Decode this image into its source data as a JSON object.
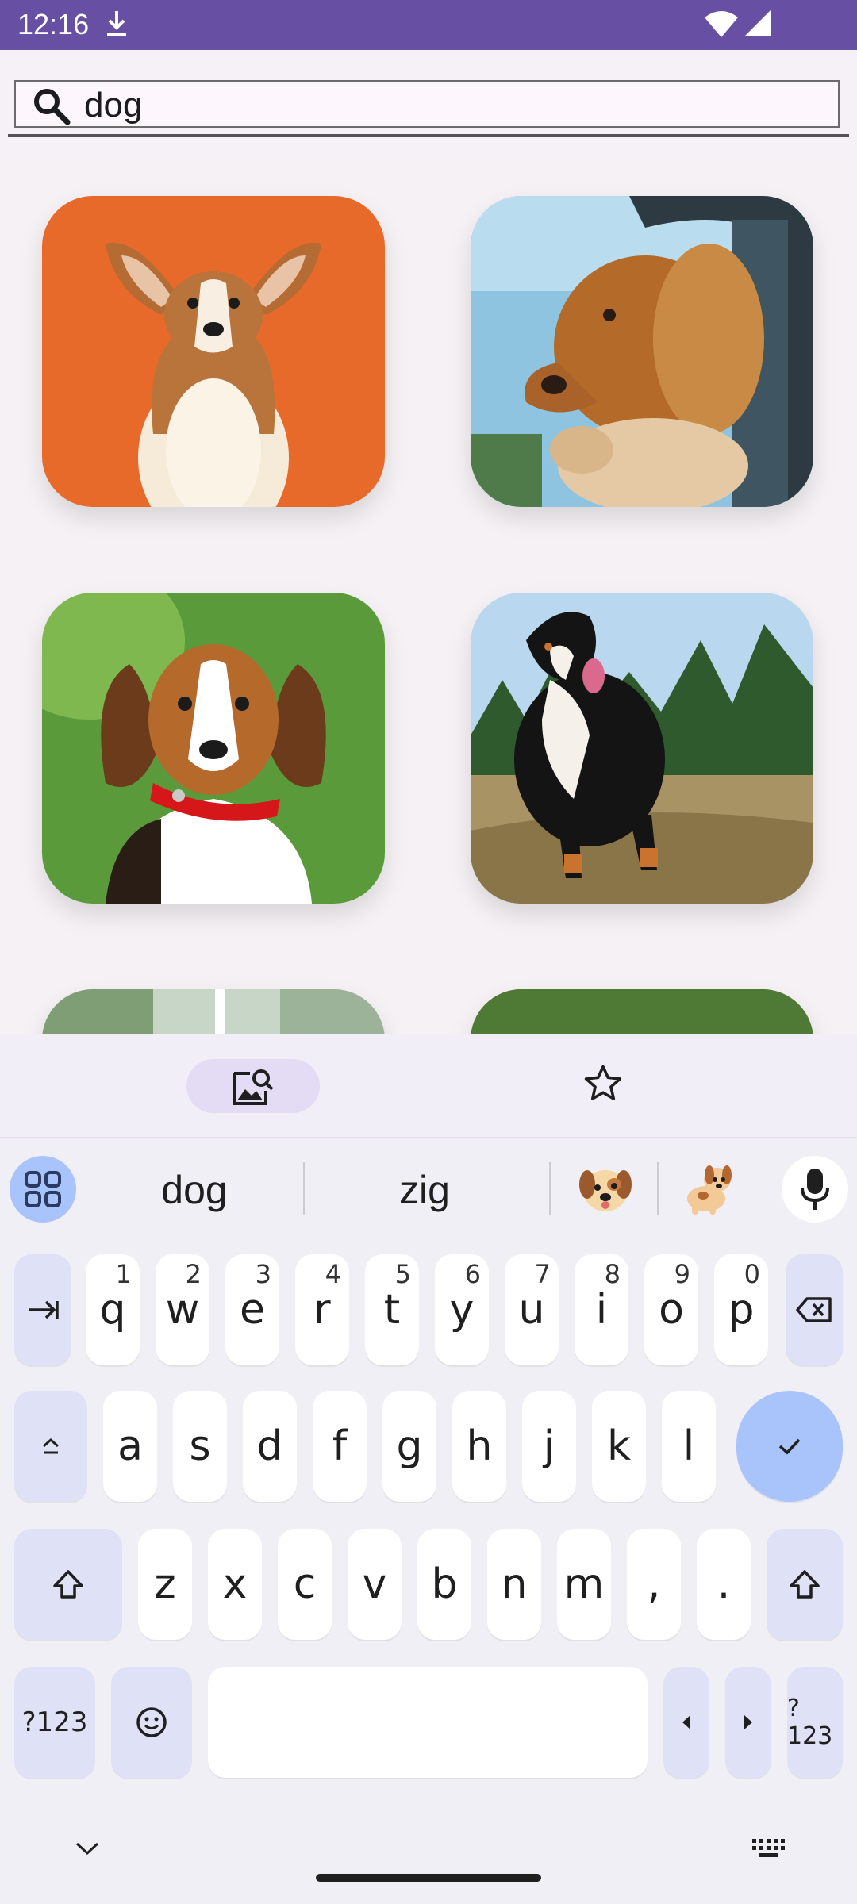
{
  "status_bar": {
    "time": "12:16",
    "icons": [
      "download-icon",
      "wifi-icon",
      "cell-signal-icon"
    ],
    "background": "#6750a4"
  },
  "search": {
    "value": "dog",
    "placeholder": ""
  },
  "results": {
    "items": [
      {
        "subject": "corgi puppy on orange background",
        "bg": "#e86a2a"
      },
      {
        "subject": "spaniel looking out of car window",
        "bg": "#8ec4df"
      },
      {
        "subject": "beagle with red collar on green background",
        "bg": "#5b9a3a"
      },
      {
        "subject": "bernese mountain dog standing in field",
        "bg": "#b9d7ef"
      },
      {
        "subject": "partially visible photo",
        "bg": "#c8d6c8"
      },
      {
        "subject": "partially visible photo",
        "bg": "#5f8a44"
      }
    ]
  },
  "keyboard_toolbar": {
    "items": [
      "image-search-icon",
      "star-icon"
    ]
  },
  "keyboard": {
    "suggestions": [
      "dog",
      "zig"
    ],
    "emoji_suggestions": [
      "dog-face-emoji",
      "dog-emoji"
    ],
    "row1": [
      {
        "label": "q",
        "hint": "1"
      },
      {
        "label": "w",
        "hint": "2"
      },
      {
        "label": "e",
        "hint": "3"
      },
      {
        "label": "r",
        "hint": "4"
      },
      {
        "label": "t",
        "hint": "5"
      },
      {
        "label": "y",
        "hint": "6"
      },
      {
        "label": "u",
        "hint": "7"
      },
      {
        "label": "i",
        "hint": "8"
      },
      {
        "label": "o",
        "hint": "9"
      },
      {
        "label": "p",
        "hint": "0"
      }
    ],
    "row2": [
      "a",
      "s",
      "d",
      "f",
      "g",
      "h",
      "j",
      "k",
      "l"
    ],
    "row3": [
      "z",
      "x",
      "c",
      "v",
      "b",
      "n",
      "m",
      ",",
      "."
    ],
    "symbols_label": "?123",
    "symbols_label_right": "?123",
    "accent": "#a9c4fb",
    "function_key_bg": "#dfe2f7"
  }
}
